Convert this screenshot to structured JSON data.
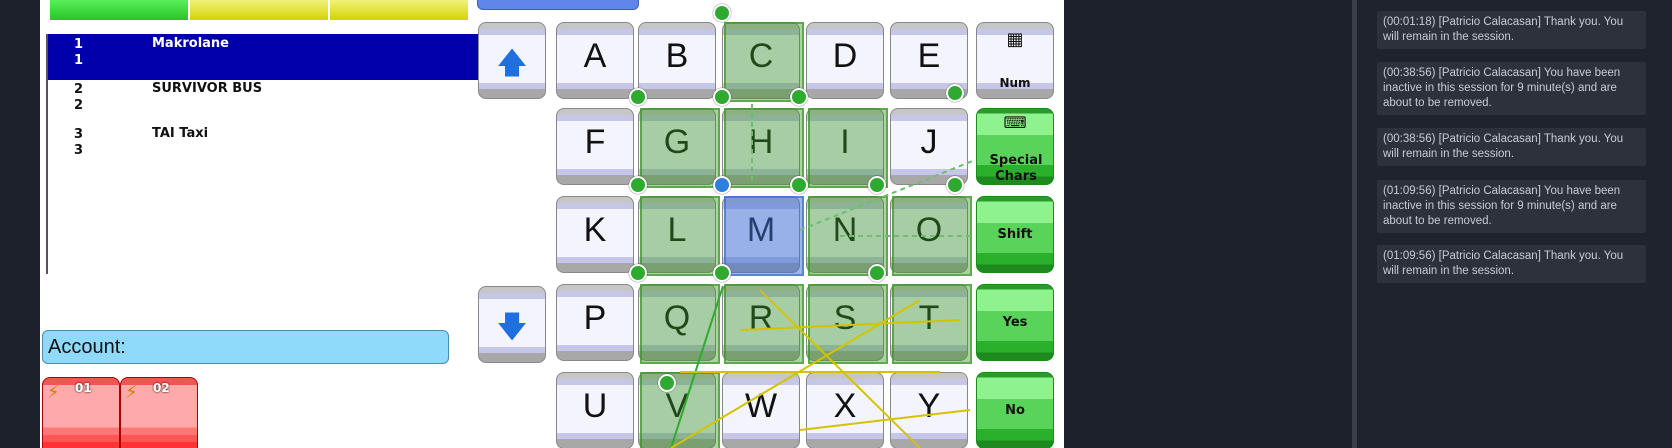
{
  "top_bar": {
    "colors": [
      "#4fe04f",
      "#e8e830",
      "#e8e830"
    ]
  },
  "list": {
    "rows": [
      {
        "num": "1",
        "num2": "1",
        "name": "Makrolane",
        "selected": true
      },
      {
        "num": "2",
        "num2": "2",
        "name": "SURVIVOR BUS",
        "selected": false
      },
      {
        "num": "3",
        "num2": "3",
        "name": "TAI Taxi",
        "selected": false
      }
    ]
  },
  "account": {
    "label": "Account:"
  },
  "tiles": [
    {
      "num": "01",
      "icon": "lightning-printer-icon"
    },
    {
      "num": "02",
      "icon": "lightning-printer-icon"
    }
  ],
  "keyboard": {
    "up_icon": "arrow-up-icon",
    "down_icon": "arrow-down-icon",
    "letters": [
      "A",
      "B",
      "C",
      "D",
      "E",
      "F",
      "G",
      "H",
      "I",
      "J",
      "K",
      "L",
      "M",
      "N",
      "O",
      "P",
      "Q",
      "R",
      "S",
      "T",
      "U",
      "V",
      "W",
      "X",
      "Y"
    ],
    "num_label": "Num",
    "num_icon": "keypad-icon",
    "special_label": "Special Chars",
    "keyboard_icon": "keyboard-icon",
    "shift_label": "Shift",
    "yes_label": "Yes",
    "no_label": "No",
    "highlighted": [
      "C",
      "G",
      "H",
      "I",
      "L",
      "M",
      "N",
      "O",
      "Q",
      "R",
      "S",
      "T",
      "V"
    ],
    "highlight_blue": "M"
  },
  "chat": {
    "messages": [
      {
        "text": "(00:01:18) [Patricio Calacasan] Thank you. You will remain in the session."
      },
      {
        "text": "(00:38:56) [Patricio Calacasan] You have been inactive in this session for 9 minute(s) and are about to be removed."
      },
      {
        "text": "(00:38:56) [Patricio Calacasan] Thank you. You will remain in the session."
      },
      {
        "text": "(01:09:56) [Patricio Calacasan] You have been inactive in this session for 9 minute(s) and are about to be removed."
      },
      {
        "text": "(01:09:56) [Patricio Calacasan] Thank you. You will remain in the session."
      }
    ]
  }
}
